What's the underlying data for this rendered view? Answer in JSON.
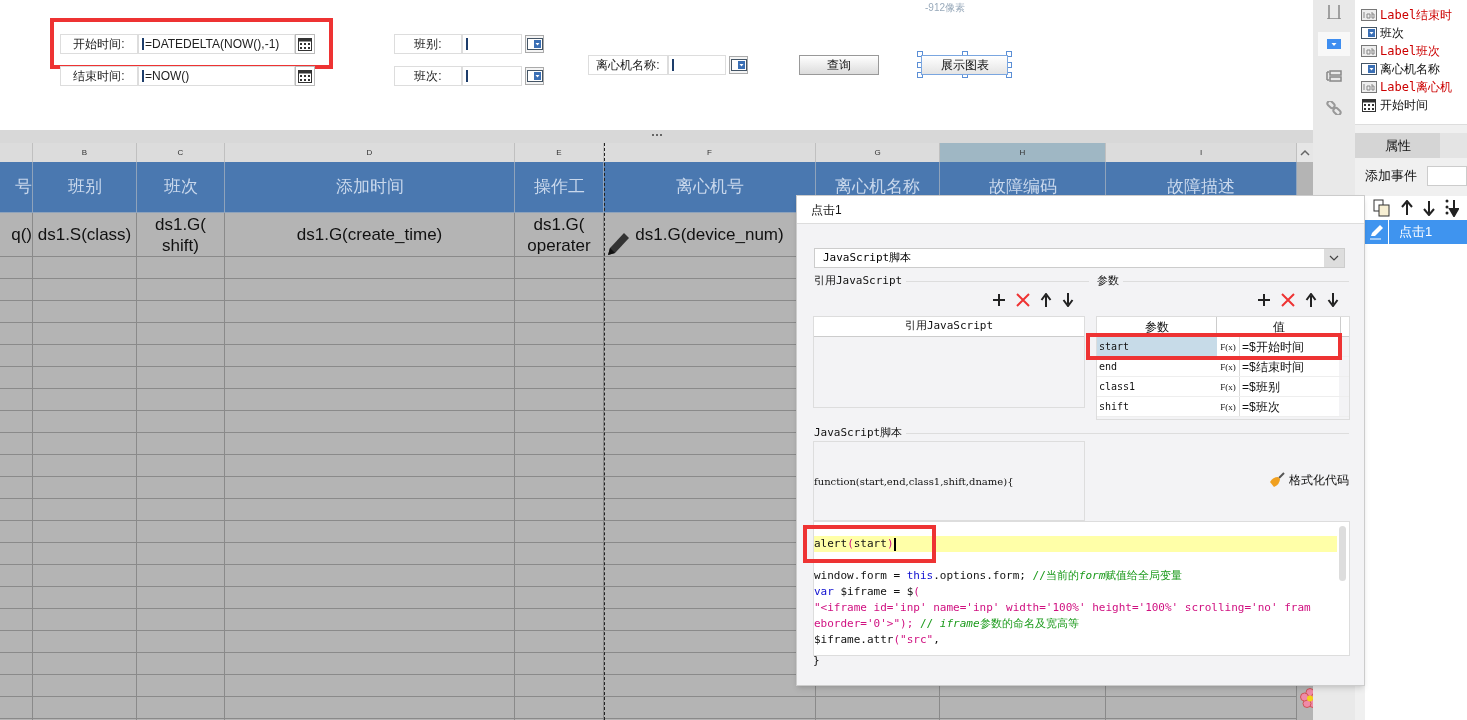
{
  "canvas": {
    "ruler_hint": "-912像素",
    "fields": [
      {
        "kind": "date",
        "label": "开始时间:",
        "value": "=DATEDELTA(NOW(),-1)",
        "highlighted": true
      },
      {
        "kind": "date",
        "label": "结束时间:",
        "value": "=NOW()",
        "highlighted": false
      },
      {
        "kind": "combo",
        "label": "班别:"
      },
      {
        "kind": "combo",
        "label": "班次:"
      },
      {
        "kind": "combo",
        "label": "离心机名称:"
      }
    ],
    "buttons": [
      {
        "label": "查询",
        "selected": false
      },
      {
        "label": "展示图表",
        "selected": true
      }
    ]
  },
  "sheet": {
    "columns": [
      {
        "header": "号",
        "cell": "q()",
        "selected": false
      },
      {
        "letter": "B",
        "header": "班别",
        "cell": "ds1.S(class)",
        "selected": false
      },
      {
        "letter": "C",
        "header": "班次",
        "cell": "ds1.G(\nshift)",
        "selected": false
      },
      {
        "letter": "D",
        "header": "添加时间",
        "cell": "ds1.G(create_time)",
        "selected": false
      },
      {
        "letter": "E",
        "header": "操作工",
        "cell": "ds1.G(\noperater",
        "selected": false
      },
      {
        "letter": "F",
        "header": "离心机号",
        "cell": "ds1.G(device_num)",
        "selected": false
      },
      {
        "letter": "G",
        "header": "离心机名称",
        "selected": false
      },
      {
        "letter": "H",
        "header": "故障编码",
        "selected": true
      },
      {
        "letter": "I",
        "header": "故障描述",
        "selected": false
      }
    ]
  },
  "side_tree": [
    {
      "kind": "label",
      "label": "Label结束时"
    },
    {
      "kind": "combo",
      "label": "班次"
    },
    {
      "kind": "label",
      "label": "Label班次"
    },
    {
      "kind": "combo",
      "label": "离心机名称"
    },
    {
      "kind": "label",
      "label": "Label离心机"
    },
    {
      "kind": "date",
      "label": "开始时间"
    }
  ],
  "side_tools": [
    {
      "kind": "frame",
      "selected": false
    },
    {
      "kind": "combo",
      "selected": true
    },
    {
      "kind": "layout",
      "selected": false
    },
    {
      "kind": "link",
      "selected": false
    }
  ],
  "properties": {
    "tabs": [
      {
        "label": "属性",
        "selected": true
      }
    ],
    "add_event_label": "添加事件",
    "events": [
      {
        "label": "点击1",
        "selected": true
      }
    ]
  },
  "dialog": {
    "title": "点击1",
    "type": "JavaScript脚本",
    "imports": {
      "title": "引用JavaScript",
      "column": "引用JavaScript"
    },
    "params": {
      "title": "参数",
      "columns": [
        "参数",
        "值"
      ],
      "rows": [
        {
          "name": "start",
          "fx": "F(x)",
          "value": "=$开始时间",
          "selected": true
        },
        {
          "name": "end",
          "fx": "F(x)",
          "value": "=$结束时间",
          "selected": false
        },
        {
          "name": "class1",
          "fx": "F(x)",
          "value": "=$班别",
          "selected": false
        },
        {
          "name": "shift",
          "fx": "F(x)",
          "value": "=$班次",
          "selected": false
        }
      ]
    },
    "script_title": "JavaScript脚本",
    "signature": "function(start,end,class1,shift,dname){",
    "format_button": "格式化代码",
    "code": [
      {
        "current": true,
        "tokens": [
          {
            "kind": "plain",
            "text": "alert"
          },
          {
            "kind": "string",
            "text": "("
          },
          {
            "kind": "plain",
            "text": "start"
          },
          {
            "kind": "string",
            "text": ")"
          }
        ]
      },
      {
        "current": false
      },
      {
        "current": false,
        "tokens": [
          {
            "kind": "plain",
            "text": "window.form = "
          },
          {
            "kind": "keyword",
            "text": "this"
          },
          {
            "kind": "plain",
            "text": ".options.form; "
          },
          {
            "kind": "comment",
            "text": "//当前的"
          },
          {
            "kind": "comment_em",
            "text": "form"
          },
          {
            "kind": "comment",
            "text": "赋值给全局变量"
          }
        ]
      },
      {
        "current": false,
        "tokens": [
          {
            "kind": "keyword",
            "text": "var"
          },
          {
            "kind": "plain",
            "text": " $iframe = $"
          },
          {
            "kind": "string",
            "text": "("
          }
        ]
      },
      {
        "current": false,
        "tokens": [
          {
            "kind": "string",
            "text": "\"<iframe id='inp' name='inp' width='100%' height='100%' scrolling='no' fram"
          }
        ]
      },
      {
        "current": false,
        "tokens": [
          {
            "kind": "string",
            "text": "eborder='0'>\");"
          },
          {
            "kind": "comment",
            "text": " // "
          },
          {
            "kind": "comment_em",
            "text": "iframe"
          },
          {
            "kind": "comment",
            "text": "参数的命名及宽高等"
          }
        ]
      },
      {
        "current": false,
        "tokens": [
          {
            "kind": "plain",
            "text": "$iframe.attr"
          },
          {
            "kind": "string",
            "text": "(\"src\""
          },
          {
            "kind": "plain",
            "text": ","
          }
        ]
      }
    ],
    "closing": "}",
    "highlight_first_param": true,
    "highlight_code": true
  }
}
